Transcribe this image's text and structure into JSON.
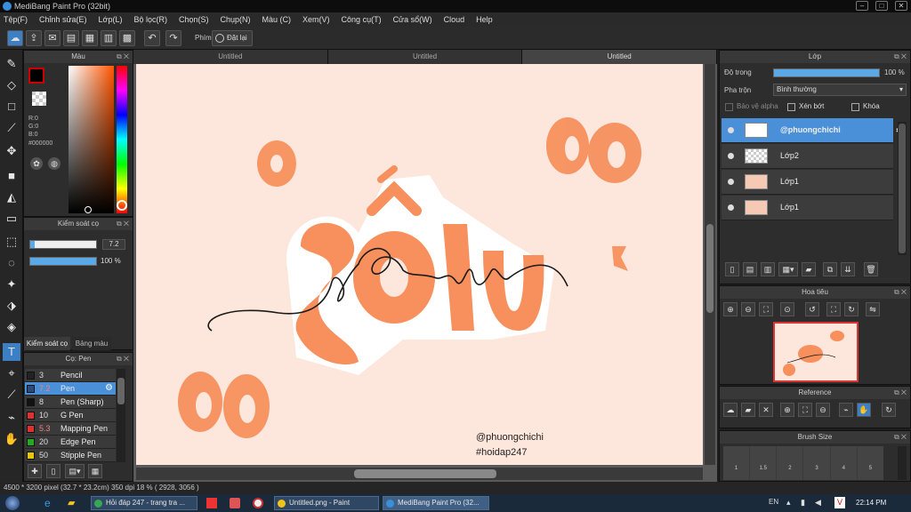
{
  "window": {
    "title": "MediBang Paint Pro (32bit)"
  },
  "menu": [
    "Tệp(F)",
    "Chỉnh sửa(E)",
    "Lớp(L)",
    "Bộ lọc(R)",
    "Chọn(S)",
    "Chụp(N)",
    "Màu (C)",
    "Xem(V)",
    "Công cụ(T)",
    "Cửa sổ(W)",
    "Cloud",
    "Help"
  ],
  "toolbar": {
    "phim_label": "Phím",
    "reset_label": "Đặt lại"
  },
  "tabs": [
    "Untitled",
    "Untitled",
    "Untitled"
  ],
  "color_panel": {
    "title": "Màu",
    "r": "R:0",
    "g": "G:0",
    "b": "B:0",
    "hex": "#000000",
    "primary_color": "#cc0000"
  },
  "brush_control": {
    "title": "Kiểm soát cọ",
    "size": "7.2",
    "size_fraction": 0.07,
    "opacity": "100 %",
    "opacity_fraction": 1.0,
    "tab1": "Kiểm soát cọ",
    "tab2": "Bảng màu"
  },
  "brush_panel": {
    "title": "Cọ: Pen",
    "items": [
      {
        "size": "3",
        "name": "Pencil",
        "color": "#222222"
      },
      {
        "size": "7.2",
        "name": "Pen",
        "color": "#2a4b80"
      },
      {
        "size": "8",
        "name": "Pen (Sharp)",
        "color": "#111111"
      },
      {
        "size": "10",
        "name": "G Pen",
        "color": "#e03030"
      },
      {
        "size": "5.3",
        "name": "Mapping Pen",
        "color": "#e03030"
      },
      {
        "size": "20",
        "name": "Edge Pen",
        "color": "#22aa22"
      },
      {
        "size": "50",
        "name": "Stipple Pen",
        "color": "#e6c800"
      }
    ]
  },
  "canvas": {
    "big_text": "sôi",
    "script_text": "sôu",
    "watermark1": "@phuongchichi",
    "watermark2": "#hoidap247",
    "accent": "#f7905d",
    "shadow": "#e6b29b",
    "background": "#fde6db"
  },
  "layer_panel": {
    "title": "Lớp",
    "opacity_label": "Độ trong",
    "opacity_value": "100 %",
    "blend_label": "Pha trộn",
    "blend_value": "Bình thường",
    "protect_alpha": "Bảo vệ alpha",
    "clip": "Xén bớt",
    "lock": "Khóa",
    "layers": [
      {
        "name": "@phuongchichi",
        "selected": true
      },
      {
        "name": "Lớp2",
        "selected": false
      },
      {
        "name": "Lớp1",
        "selected": false
      },
      {
        "name": "Lớp1",
        "selected": false
      }
    ]
  },
  "navigator": {
    "title": "Hoa tiêu"
  },
  "reference": {
    "title": "Reference"
  },
  "brush_size_panel": {
    "title": "Brush Size",
    "sizes": [
      "1",
      "1.5",
      "2",
      "3",
      "4",
      "5"
    ]
  },
  "status": {
    "text": "4500 * 3200 pixel  (32.7 * 23.2cm)  350 dpi  18 %  ( 2928, 3056 )"
  },
  "taskbar": {
    "items": [
      {
        "label": "Hỏi đáp 247 - trang tra ...",
        "color": "#34a853"
      },
      {
        "label": "Untitled.png - Paint",
        "color": "#f0c419"
      },
      {
        "label": "MediBang Paint Pro (32...",
        "color": "#3a8fd8"
      }
    ],
    "lang": "EN",
    "time": "22:14 PM"
  }
}
